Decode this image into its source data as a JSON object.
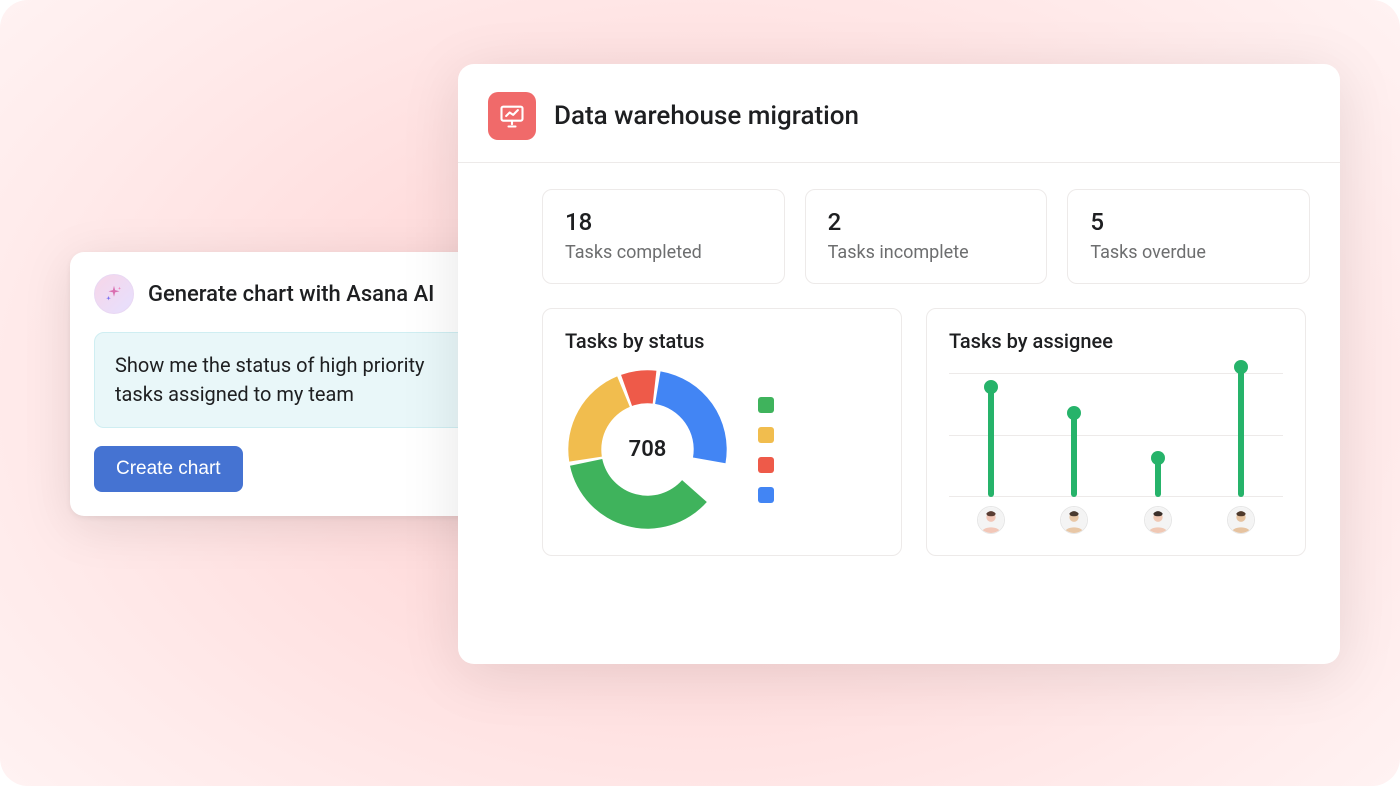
{
  "ai_panel": {
    "title": "Generate chart with Asana AI",
    "prompt_text": "Show me the status of high priority tasks assigned to my team",
    "create_button": "Create chart"
  },
  "dashboard": {
    "title": "Data warehouse migration",
    "stats": [
      {
        "value": "18",
        "label": "Tasks completed"
      },
      {
        "value": "2",
        "label": "Tasks incomplete"
      },
      {
        "value": "5",
        "label": "Tasks overdue"
      }
    ],
    "donut": {
      "title": "Tasks by status",
      "center_value": "708"
    },
    "bars": {
      "title": "Tasks by assignee"
    }
  },
  "chart_data": [
    {
      "type": "pie",
      "title": "Tasks by status",
      "center_total": 708,
      "series": [
        {
          "name": "Green",
          "color": "#3fb35c",
          "value": 255
        },
        {
          "name": "Yellow",
          "color": "#f1bd4e",
          "value": 156
        },
        {
          "name": "Red",
          "color": "#ee5a49",
          "value": 57
        },
        {
          "name": "Blue",
          "color": "#4285f4",
          "value": 184
        },
        {
          "name": "Gap",
          "color": "#ffffff",
          "value": 56
        }
      ]
    },
    {
      "type": "bar",
      "title": "Tasks by assignee",
      "categories": [
        "Assignee 1",
        "Assignee 2",
        "Assignee 3",
        "Assignee 4"
      ],
      "values": [
        85,
        65,
        30,
        100
      ],
      "ylim": [
        0,
        100
      ]
    }
  ]
}
